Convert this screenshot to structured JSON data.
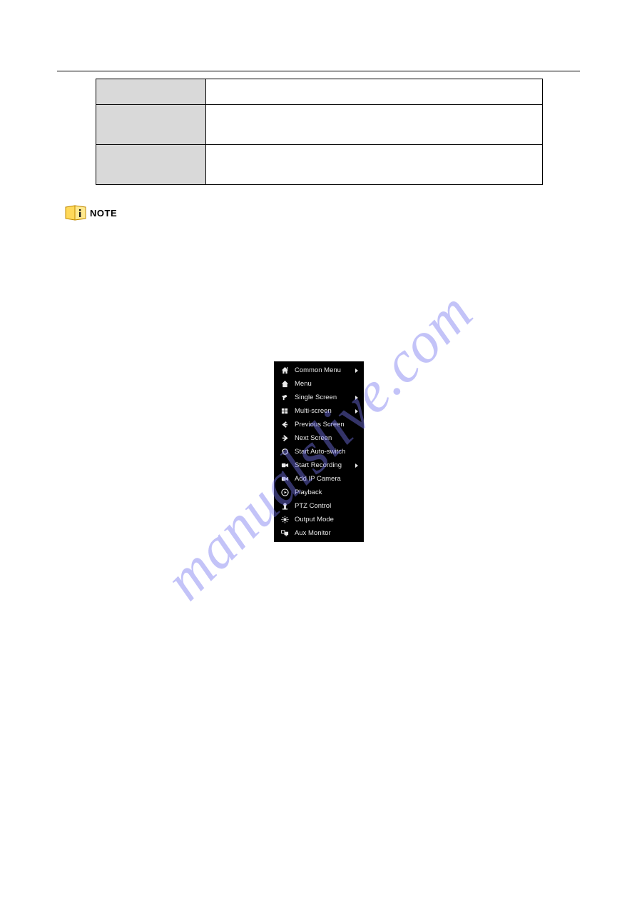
{
  "header": {
    "left": "",
    "right": ""
  },
  "table": {
    "rows": [
      {
        "label": "",
        "desc": ""
      },
      {
        "label": "",
        "desc": ""
      },
      {
        "label": "",
        "desc": ""
      }
    ]
  },
  "note": {
    "label": "NOTE"
  },
  "body_paragraphs": [],
  "context_menu": {
    "items": [
      {
        "icon": "home-fancy",
        "label": "Common Menu",
        "submenu": true
      },
      {
        "icon": "home",
        "label": "Menu",
        "submenu": false
      },
      {
        "icon": "camera-tilt",
        "label": "Single Screen",
        "submenu": true
      },
      {
        "icon": "grid",
        "label": "Multi-screen",
        "submenu": true
      },
      {
        "icon": "arrow-left",
        "label": "Previous Screen",
        "submenu": false
      },
      {
        "icon": "arrow-right",
        "label": "Next Screen",
        "submenu": false
      },
      {
        "icon": "refresh",
        "label": "Start Auto-switch",
        "submenu": false
      },
      {
        "icon": "camcorder",
        "label": "Start Recording",
        "submenu": true
      },
      {
        "icon": "camcorder-plus",
        "label": "Add IP Camera",
        "submenu": false
      },
      {
        "icon": "play-circle",
        "label": "Playback",
        "submenu": false
      },
      {
        "icon": "ptz",
        "label": "PTZ Control",
        "submenu": false
      },
      {
        "icon": "sun",
        "label": "Output Mode",
        "submenu": false
      },
      {
        "icon": "monitor",
        "label": "Aux Monitor",
        "submenu": false
      }
    ]
  },
  "figure_caption": "",
  "page_number": "",
  "watermark": "manualslive.com"
}
